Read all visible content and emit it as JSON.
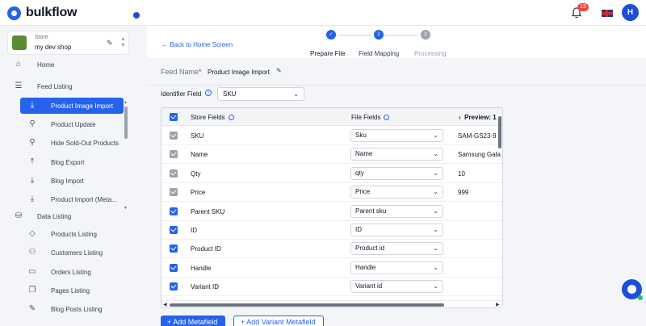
{
  "app": {
    "name": "bulkflow",
    "notification_count": "13",
    "avatar_initial": "H"
  },
  "store": {
    "label": "Store",
    "name": "my dev shop"
  },
  "sidebar": {
    "items": [
      {
        "label": "Home",
        "icon": "home-icon",
        "level": "top",
        "active": false
      },
      {
        "label": "Feed Listing",
        "icon": "list-icon",
        "level": "top",
        "active": false
      },
      {
        "label": "Product Image Import",
        "icon": "download-icon",
        "level": "sub",
        "active": true
      },
      {
        "label": "Product Update",
        "icon": "person-walk-icon",
        "level": "sub",
        "active": false
      },
      {
        "label": "Hide Sold-Out Products",
        "icon": "person-walk-icon",
        "level": "sub",
        "active": false
      },
      {
        "label": "Blog Export",
        "icon": "upload-icon",
        "level": "sub",
        "active": false
      },
      {
        "label": "Blog Import",
        "icon": "download-icon",
        "level": "sub",
        "active": false
      },
      {
        "label": "Product Import (Meta...",
        "icon": "download-icon",
        "level": "sub",
        "active": false
      },
      {
        "label": "Data Listing",
        "icon": "database-icon",
        "level": "top",
        "active": false
      },
      {
        "label": "Products Listing",
        "icon": "tag-icon",
        "level": "sub",
        "active": false
      },
      {
        "label": "Customers Listing",
        "icon": "user-add-icon",
        "level": "sub",
        "active": false
      },
      {
        "label": "Orders Listing",
        "icon": "inbox-icon",
        "level": "sub",
        "active": false
      },
      {
        "label": "Pages Listing",
        "icon": "pages-icon",
        "level": "sub",
        "active": false
      },
      {
        "label": "Blog Posts Listing",
        "icon": "edit-icon",
        "level": "sub",
        "active": false
      }
    ]
  },
  "header": {
    "back_label": "Back to Home Screen",
    "steps": [
      {
        "label": "Prepare File",
        "number": "1",
        "state": "done"
      },
      {
        "label": "Field Mapping",
        "number": "2",
        "state": "current"
      },
      {
        "label": "Processing",
        "number": "3",
        "state": "pending"
      }
    ]
  },
  "feed": {
    "label": "Feed Name",
    "value": "Product Image Import"
  },
  "identifier": {
    "label": "Identifier Field",
    "value": "SKU"
  },
  "table": {
    "col_store": "Store Fields",
    "col_file": "File Fields",
    "col_preview": "Preview: 1",
    "rows": [
      {
        "store": "SKU",
        "file": "Sku",
        "preview": "SAM-GS23-9",
        "check": "disabled"
      },
      {
        "store": "Name",
        "file": "Name",
        "preview": "Samsung Gala",
        "check": "disabled"
      },
      {
        "store": "Qty",
        "file": "qty",
        "preview": "10",
        "check": "disabled"
      },
      {
        "store": "Price",
        "file": "Price",
        "preview": "999",
        "check": "disabled"
      },
      {
        "store": "Parent SKU",
        "file": "Parent sku",
        "preview": "",
        "check": "on"
      },
      {
        "store": "ID",
        "file": "ID",
        "preview": "",
        "check": "on"
      },
      {
        "store": "Product ID",
        "file": "Product id",
        "preview": "",
        "check": "on"
      },
      {
        "store": "Handle",
        "file": "Handle",
        "preview": "",
        "check": "on"
      },
      {
        "store": "Variant ID",
        "file": "Variant id",
        "preview": "",
        "check": "on"
      }
    ]
  },
  "actions": {
    "add_metafield": "+ Add Metafield",
    "add_variant_metafield": "+ Add Variant Metafield"
  },
  "colors": {
    "primary": "#2563eb",
    "badge": "#ef4444"
  }
}
